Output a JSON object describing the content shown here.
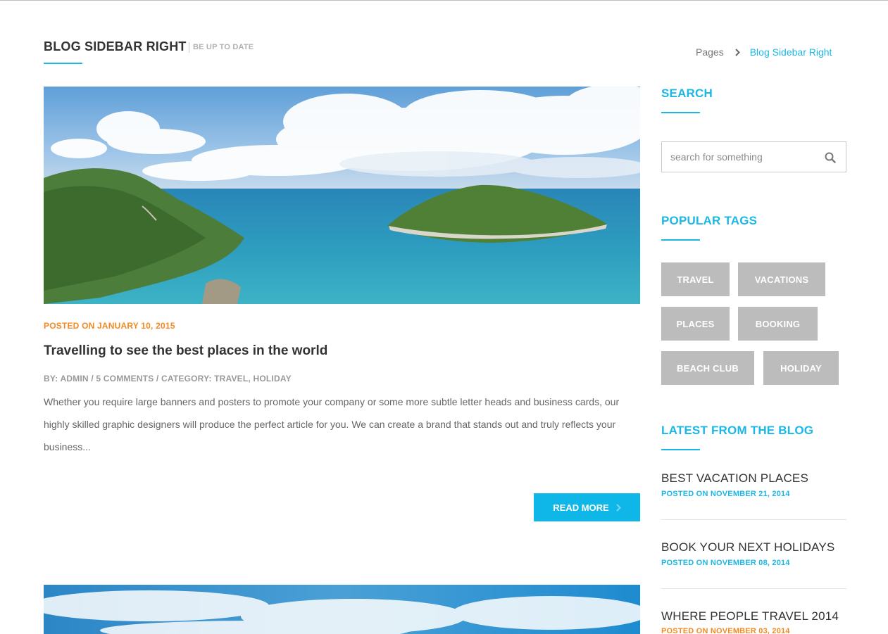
{
  "header": {
    "title": "BLOG SIDEBAR RIGHT",
    "subtitle": "BE UP TO DATE",
    "breadcrumb": {
      "parent": "Pages",
      "current": "Blog Sidebar Right"
    }
  },
  "post": {
    "date": "POSTED ON JANUARY 10, 2015",
    "title": "Travelling to see the best places in the world",
    "meta": "BY: ADMIN / 5 COMMENTS / CATEGORY: TRAVEL, HOLIDAY",
    "excerpt": "Whether you require large banners and posters to promote your company or some more subtle letter heads and business cards, our highly skilled graphic designers will produce the perfect article for you. We can create a brand that stands out and truly reflects your business...",
    "read_more": "READ MORE"
  },
  "sidebar": {
    "search": {
      "title": "SEARCH",
      "placeholder": "search for something",
      "value": ""
    },
    "tags": {
      "title": "POPULAR TAGS",
      "items": [
        "TRAVEL",
        "VACATIONS",
        "PLACES",
        "BOOKING",
        "BEACH CLUB",
        "HOLIDAY"
      ]
    },
    "latest": {
      "title": "LATEST FROM THE BLOG",
      "items": [
        {
          "title": "BEST VACATION PLACES",
          "date": "POSTED ON NOVEMBER 21, 2014"
        },
        {
          "title": "BOOK YOUR NEXT HOLIDAYS",
          "date": "POSTED ON NOVEMBER 08, 2014"
        },
        {
          "title": "WHERE PEOPLE TRAVEL 2014",
          "date": "POSTED ON NOVEMBER 03, 2014"
        }
      ]
    }
  },
  "colors": {
    "accent": "#1bb8e6",
    "date_orange": "#f5891f",
    "tag_bg": "#bcbcbc",
    "button": "#0fb6e8"
  },
  "icons": {
    "search": "magnifier-icon",
    "breadcrumb_sep": "chevron-right-icon",
    "read_more": "chevron-right-icon"
  }
}
